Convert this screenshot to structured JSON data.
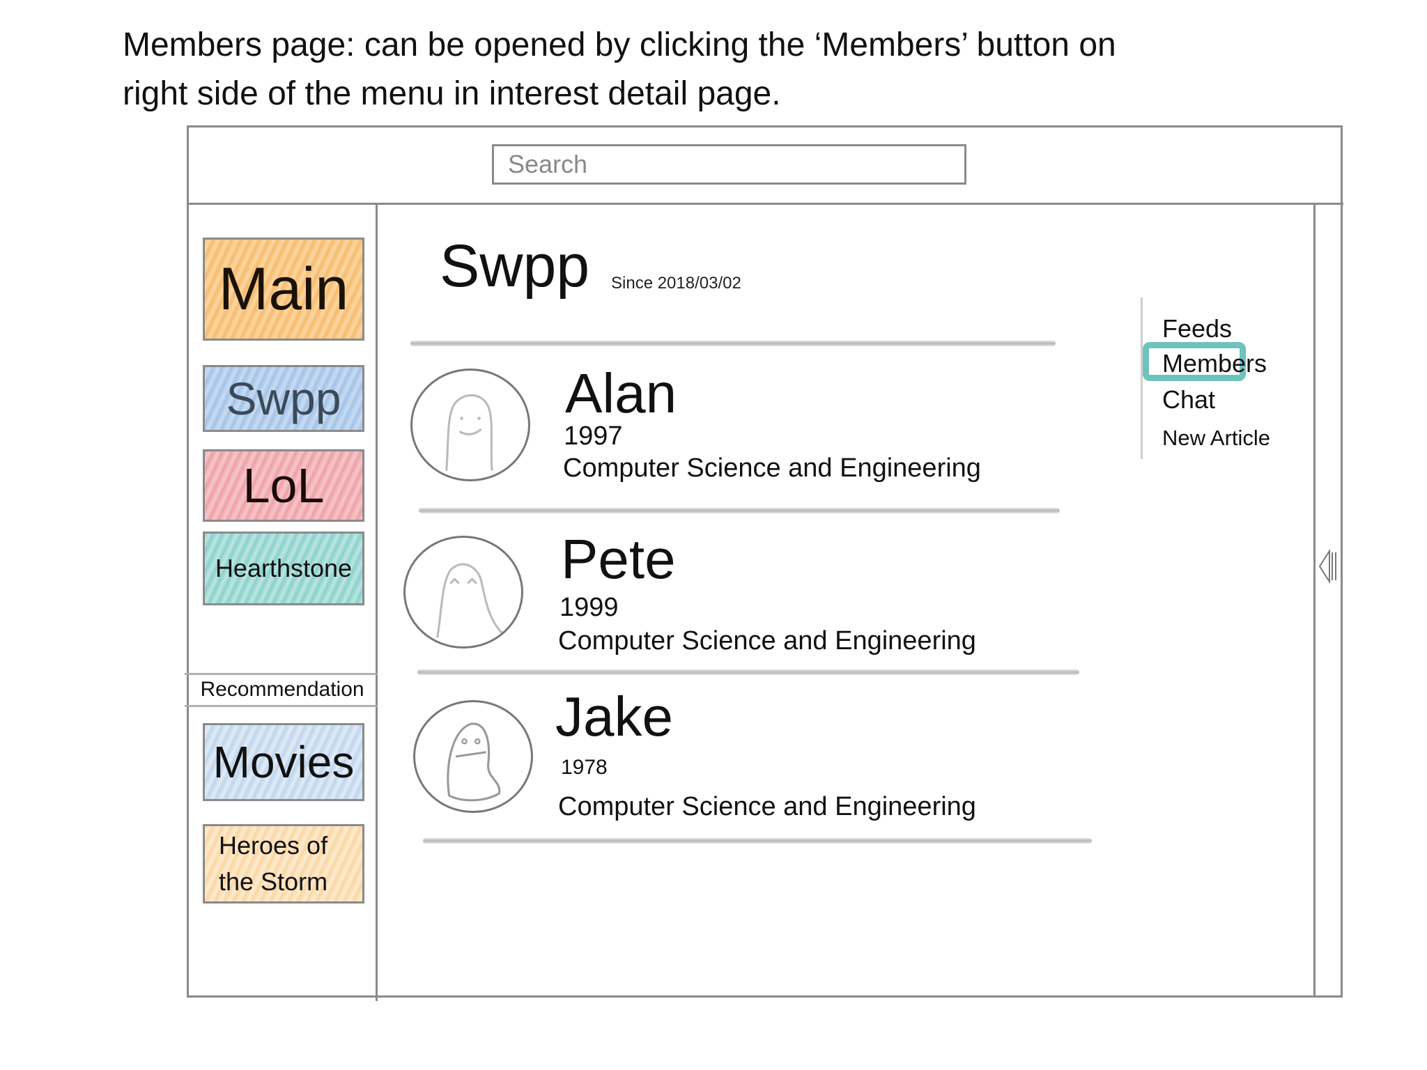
{
  "caption": {
    "line1": "Members page: can be opened by clicking the ‘Members’ button on",
    "line2": "right side of the menu in interest detail page."
  },
  "search": {
    "placeholder": "Search"
  },
  "sidebar": {
    "items": [
      {
        "label": "Main",
        "color": "#f7c07a"
      },
      {
        "label": "Swpp",
        "color": "#a9c8ea"
      },
      {
        "label": "LoL",
        "color": "#f0a8ad"
      },
      {
        "label": "Hearthstone",
        "color": "#8fd4cf"
      }
    ],
    "recommendation_label": "Recommendation",
    "recommendations": [
      {
        "label": "Movies",
        "color": "#c4d9ef"
      },
      {
        "label_line1": "Heroes of",
        "label_line2": "the Storm",
        "color": "#fbdcae"
      }
    ]
  },
  "group": {
    "title": "Swpp",
    "since": "Since 2018/03/02"
  },
  "members": [
    {
      "name": "Alan",
      "year": "1997",
      "department": "Computer Science and Engineering"
    },
    {
      "name": "Pete",
      "year": "1999",
      "department": "Computer Science and Engineering"
    },
    {
      "name": "Jake",
      "year": "1978",
      "department": "Computer Science and Engineering"
    }
  ],
  "menu": {
    "items": [
      "Feeds",
      "Members",
      "Chat",
      "New Article"
    ],
    "active": "Members",
    "highlight_color": "#6fc3bd"
  },
  "icons": {
    "collapse": "collapse-panel-icon"
  }
}
